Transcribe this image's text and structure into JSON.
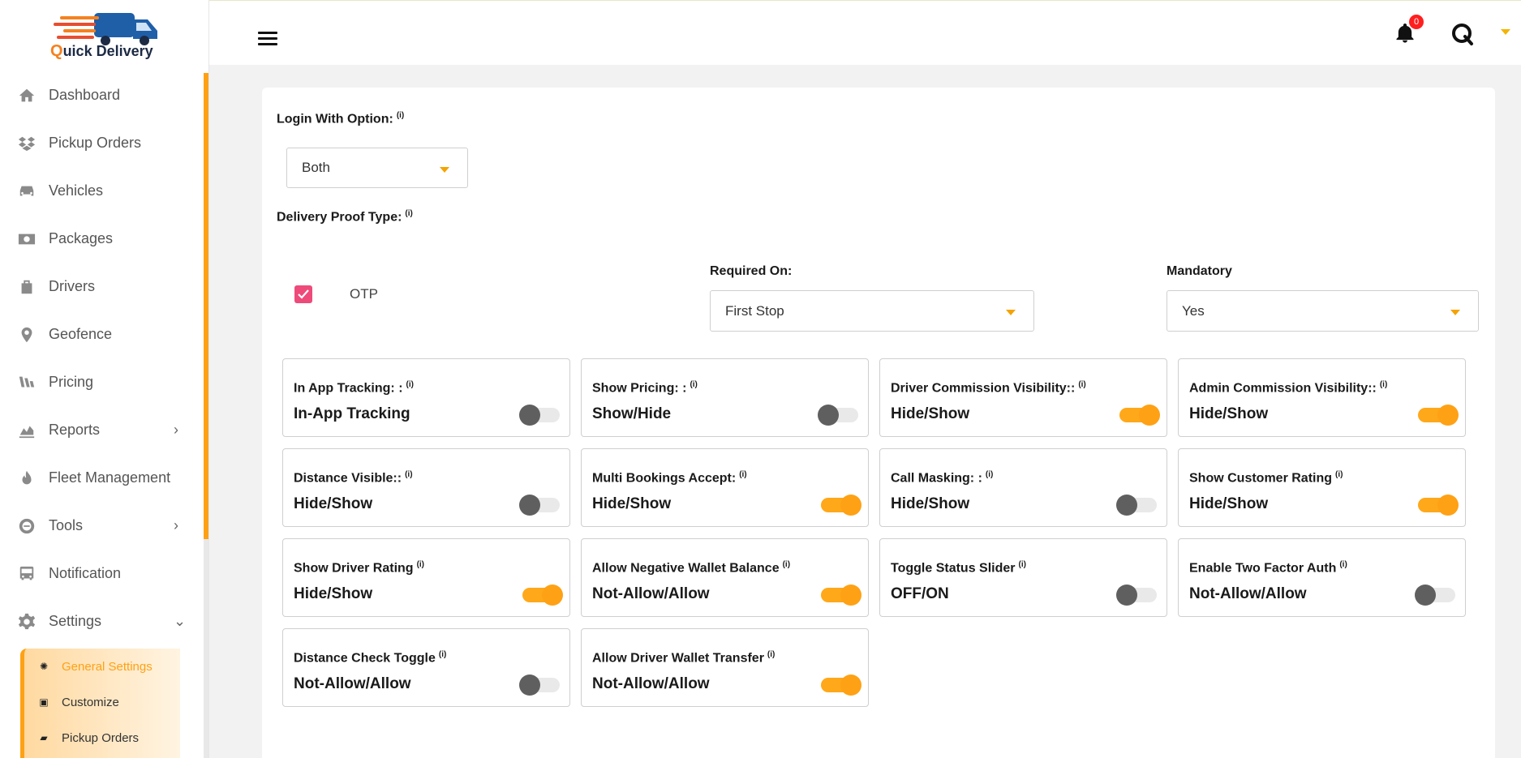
{
  "brand": {
    "q": "Q",
    "rest": "uick Delivery"
  },
  "sidebar": {
    "items": [
      {
        "label": "Dashboard",
        "icon": "home-icon",
        "chevron": ""
      },
      {
        "label": "Pickup Orders",
        "icon": "dropbox-icon",
        "chevron": ""
      },
      {
        "label": "Vehicles",
        "icon": "car-icon",
        "chevron": ""
      },
      {
        "label": "Packages",
        "icon": "money-icon",
        "chevron": ""
      },
      {
        "label": "Drivers",
        "icon": "suitcase-icon",
        "chevron": ""
      },
      {
        "label": "Geofence",
        "icon": "map-pin-icon",
        "chevron": ""
      },
      {
        "label": "Pricing",
        "icon": "pricing-icon",
        "chevron": ""
      },
      {
        "label": "Reports",
        "icon": "chart-icon",
        "chevron": "›"
      },
      {
        "label": "Fleet Management",
        "icon": "fire-icon",
        "chevron": ""
      },
      {
        "label": "Tools",
        "icon": "tools-icon",
        "chevron": "›"
      },
      {
        "label": "Notification",
        "icon": "bus-icon",
        "chevron": ""
      },
      {
        "label": "Settings",
        "icon": "gear-icon",
        "chevron": "⌄"
      }
    ],
    "submenu": [
      {
        "label": "General Settings",
        "icon": "✺",
        "active": true
      },
      {
        "label": "Customize",
        "icon": "▣",
        "active": false
      },
      {
        "label": "Pickup Orders",
        "icon": "▰",
        "active": false
      }
    ]
  },
  "header": {
    "notification_count": "0"
  },
  "form": {
    "login_option": {
      "label": "Login With Option:",
      "info": "(i)",
      "value": "Both"
    },
    "proof_type": {
      "label": "Delivery Proof Type:",
      "info": "(i)"
    },
    "otp": {
      "label": "OTP",
      "checked": true
    },
    "required_on": {
      "label": "Required On:",
      "value": "First Stop"
    },
    "mandatory": {
      "label": "Mandatory",
      "value": "Yes"
    }
  },
  "settings": [
    {
      "title": "In App Tracking: :",
      "value": "In-App Tracking",
      "on": false
    },
    {
      "title": "Show Pricing: :",
      "value": "Show/Hide",
      "on": false
    },
    {
      "title": "Driver Commission Visibility::",
      "value": "Hide/Show",
      "on": true
    },
    {
      "title": "Admin Commission Visibility::",
      "value": "Hide/Show",
      "on": true
    },
    {
      "title": "Distance Visible::",
      "value": "Hide/Show",
      "on": false
    },
    {
      "title": "Multi Bookings Accept:",
      "value": "Hide/Show",
      "on": true
    },
    {
      "title": "Call Masking: :",
      "value": "Hide/Show",
      "on": false
    },
    {
      "title": "Show Customer Rating",
      "value": "Hide/Show",
      "on": true
    },
    {
      "title": "Show Driver Rating",
      "value": "Hide/Show",
      "on": true
    },
    {
      "title": "Allow Negative Wallet Balance",
      "value": "Not-Allow/Allow",
      "on": true
    },
    {
      "title": "Toggle Status Slider",
      "value": "OFF/ON",
      "on": false
    },
    {
      "title": "Enable Two Factor Auth",
      "value": "Not-Allow/Allow",
      "on": false
    },
    {
      "title": "Distance Check Toggle",
      "value": "Not-Allow/Allow",
      "on": false
    },
    {
      "title": "Allow Driver Wallet Transfer",
      "value": "Not-Allow/Allow",
      "on": true
    }
  ],
  "info_glyph": "(i)",
  "colors": {
    "accent": "#ffa114",
    "checkbox": "#ee4a7a",
    "badge": "#ff1f1f"
  }
}
